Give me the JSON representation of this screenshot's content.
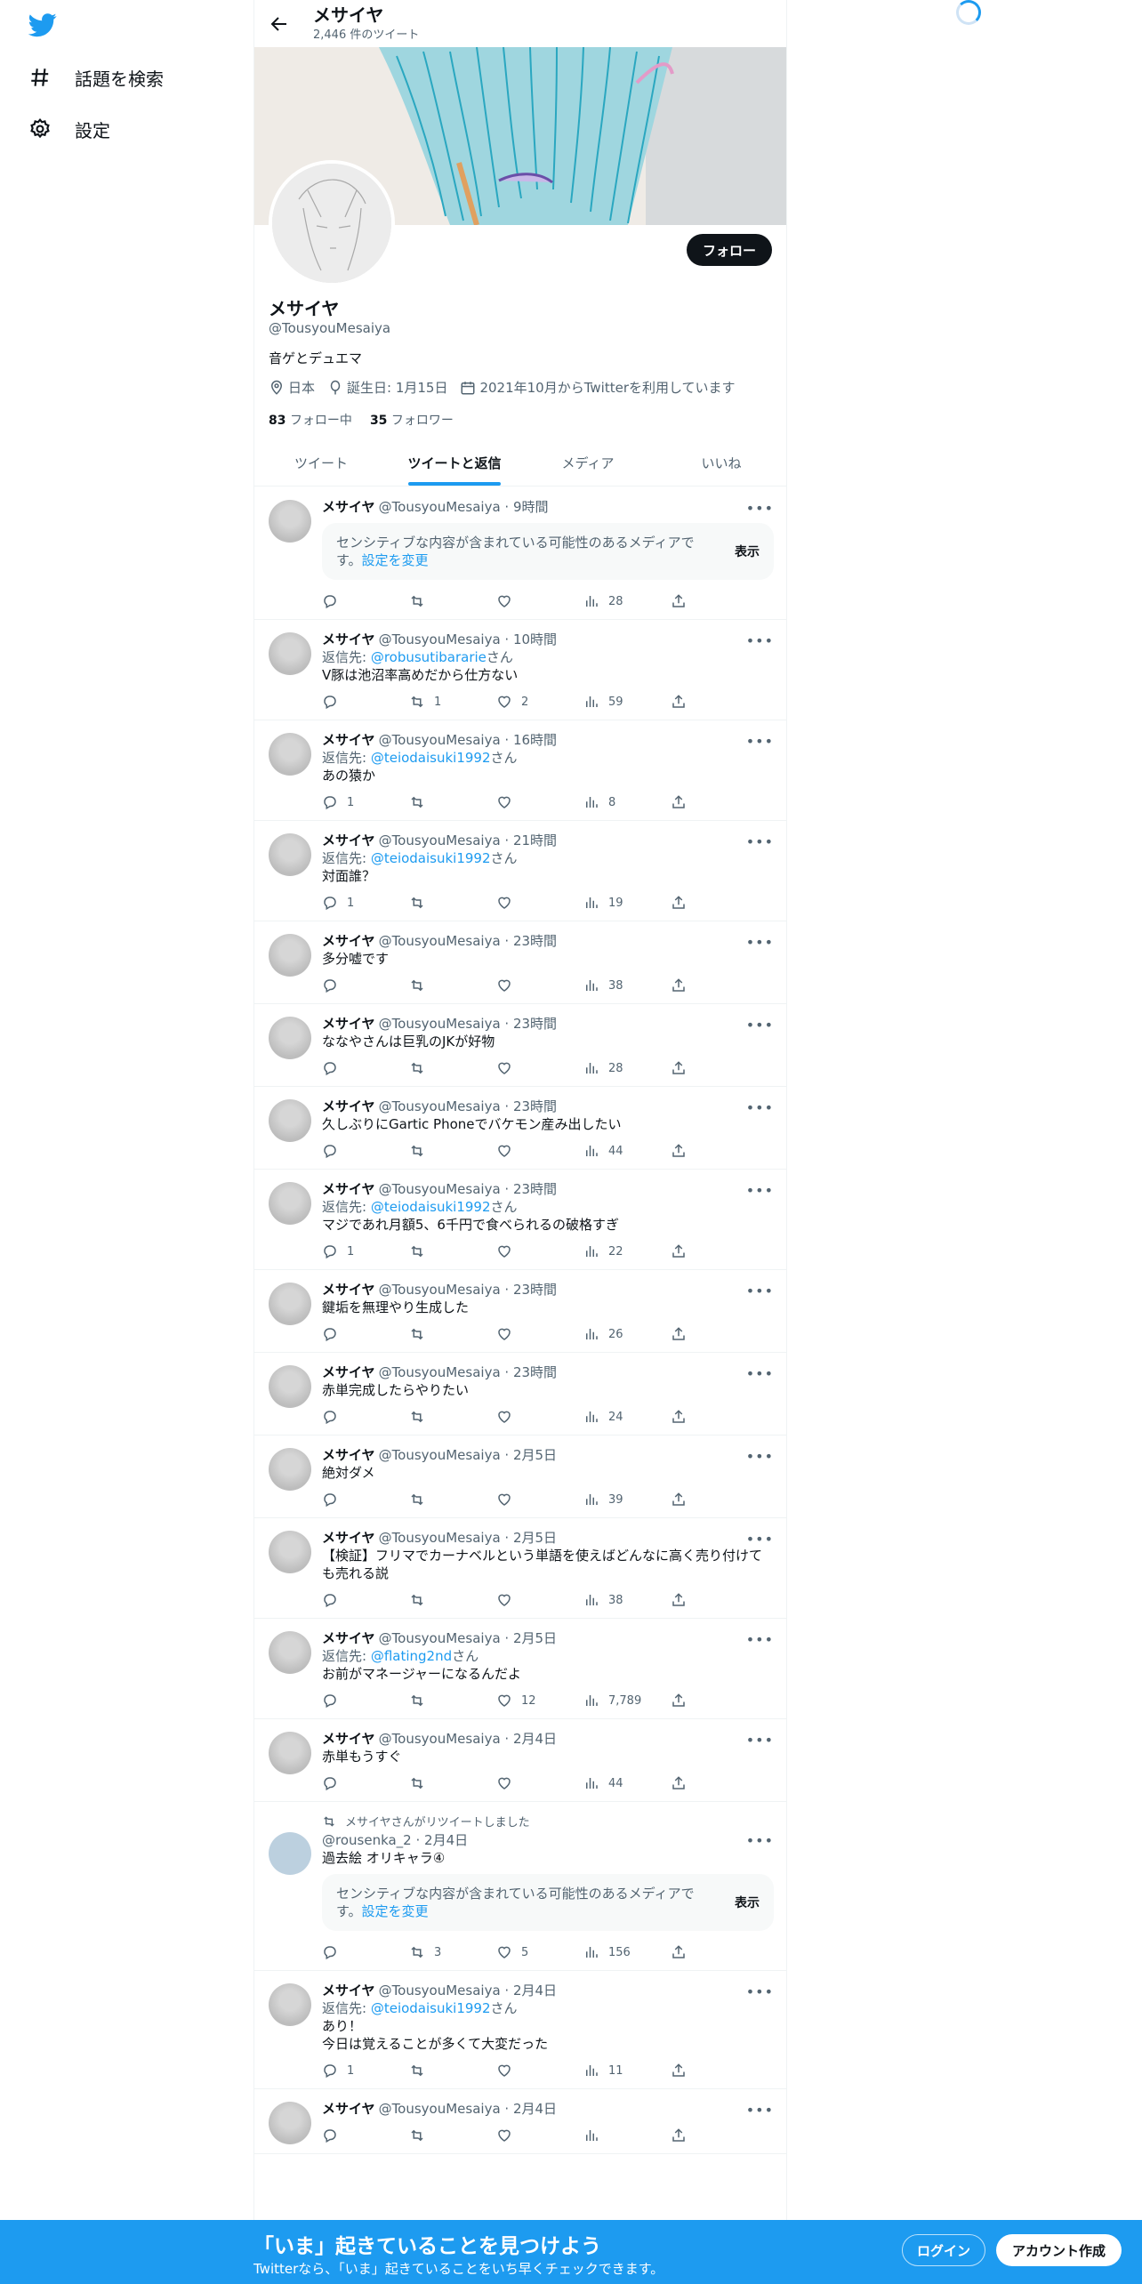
{
  "sidebar": {
    "items": [
      {
        "icon": "hashtag-icon",
        "label": "話題を検索"
      },
      {
        "icon": "gear-icon",
        "label": "設定"
      }
    ]
  },
  "header": {
    "name": "メサイヤ",
    "tweet_count": "2,446 件のツイート"
  },
  "profile": {
    "name": "メサイヤ",
    "handle": "@TousyouMesaiya",
    "bio": "音ゲとデュエマ",
    "location": "日本",
    "birthday": "誕生日: 1月15日",
    "joined": "2021年10月からTwitterを利用しています",
    "following_count": "83",
    "following_label": "フォロー中",
    "followers_count": "35",
    "followers_label": "フォロワー",
    "follow_button": "フォロー"
  },
  "tabs": [
    {
      "label": "ツイート"
    },
    {
      "label": "ツイートと返信"
    },
    {
      "label": "メディア"
    },
    {
      "label": "いいね"
    }
  ],
  "tweets": [
    {
      "name": "メサイヤ",
      "handle": "@TousyouMesaiya",
      "time": "9時間",
      "reply_to": "",
      "text": "",
      "sensitive": true,
      "replies": "",
      "retweets": "",
      "likes": "",
      "views": "28"
    },
    {
      "name": "メサイヤ",
      "handle": "@TousyouMesaiya",
      "time": "10時間",
      "reply_to": "@robusutibararie",
      "text": "V豚は池沼率高めだから仕方ない",
      "sensitive": false,
      "replies": "",
      "retweets": "1",
      "likes": "2",
      "views": "59"
    },
    {
      "name": "メサイヤ",
      "handle": "@TousyouMesaiya",
      "time": "16時間",
      "reply_to": "@teiodaisuki1992",
      "text": "あの猿か",
      "sensitive": false,
      "replies": "1",
      "retweets": "",
      "likes": "",
      "views": "8"
    },
    {
      "name": "メサイヤ",
      "handle": "@TousyouMesaiya",
      "time": "21時間",
      "reply_to": "@teiodaisuki1992",
      "text": "対面誰？",
      "sensitive": false,
      "replies": "1",
      "retweets": "",
      "likes": "",
      "views": "19"
    },
    {
      "name": "メサイヤ",
      "handle": "@TousyouMesaiya",
      "time": "23時間",
      "reply_to": "",
      "text": "多分嘘です",
      "sensitive": false,
      "replies": "",
      "retweets": "",
      "likes": "",
      "views": "38"
    },
    {
      "name": "メサイヤ",
      "handle": "@TousyouMesaiya",
      "time": "23時間",
      "reply_to": "",
      "text": "ななやさんは巨乳のJKが好物",
      "sensitive": false,
      "replies": "",
      "retweets": "",
      "likes": "",
      "views": "28"
    },
    {
      "name": "メサイヤ",
      "handle": "@TousyouMesaiya",
      "time": "23時間",
      "reply_to": "",
      "text": "久しぶりにGartic Phoneでバケモン産み出したい",
      "sensitive": false,
      "replies": "",
      "retweets": "",
      "likes": "",
      "views": "44"
    },
    {
      "name": "メサイヤ",
      "handle": "@TousyouMesaiya",
      "time": "23時間",
      "reply_to": "@teiodaisuki1992",
      "text": "マジであれ月額5、6千円で食べられるの破格すぎ",
      "sensitive": false,
      "replies": "1",
      "retweets": "",
      "likes": "",
      "views": "22"
    },
    {
      "name": "メサイヤ",
      "handle": "@TousyouMesaiya",
      "time": "23時間",
      "reply_to": "",
      "text": "鍵垢を無理やり生成した",
      "sensitive": false,
      "replies": "",
      "retweets": "",
      "likes": "",
      "views": "26"
    },
    {
      "name": "メサイヤ",
      "handle": "@TousyouMesaiya",
      "time": "23時間",
      "reply_to": "",
      "text": "赤単完成したらやりたい",
      "sensitive": false,
      "replies": "",
      "retweets": "",
      "likes": "",
      "views": "24"
    },
    {
      "name": "メサイヤ",
      "handle": "@TousyouMesaiya",
      "time": "2月5日",
      "reply_to": "",
      "text": "絶対ダメ",
      "sensitive": false,
      "replies": "",
      "retweets": "",
      "likes": "",
      "views": "39"
    },
    {
      "name": "メサイヤ",
      "handle": "@TousyouMesaiya",
      "time": "2月5日",
      "reply_to": "",
      "text": "【検証】フリマでカーナベルという単語を使えばどんなに高く売り付けても売れる説",
      "sensitive": false,
      "replies": "",
      "retweets": "",
      "likes": "",
      "views": "38"
    },
    {
      "name": "メサイヤ",
      "handle": "@TousyouMesaiya",
      "time": "2月5日",
      "reply_to": "@flating2nd",
      "text": "お前がマネージャーになるんだよ",
      "sensitive": false,
      "replies": "",
      "retweets": "",
      "likes": "12",
      "views": "7,789"
    },
    {
      "name": "メサイヤ",
      "handle": "@TousyouMesaiya",
      "time": "2月4日",
      "reply_to": "",
      "text": "赤単もうすぐ",
      "sensitive": false,
      "replies": "",
      "retweets": "",
      "likes": "",
      "views": "44"
    },
    {
      "retweeted_by": "メサイヤさんがリツイートしました",
      "name": "",
      "handle": "@rousenka_2",
      "time": "2月4日",
      "reply_to": "",
      "text": "過去絵 オリキャラ④",
      "sensitive": true,
      "replies": "",
      "retweets": "3",
      "likes": "5",
      "views": "156"
    },
    {
      "name": "メサイヤ",
      "handle": "@TousyouMesaiya",
      "time": "2月4日",
      "reply_to": "@teiodaisuki1992",
      "text": "あり！\n今日は覚えることが多くて大変だった",
      "sensitive": false,
      "replies": "1",
      "retweets": "",
      "likes": "",
      "views": "11"
    },
    {
      "name": "メサイヤ",
      "handle": "@TousyouMesaiya",
      "time": "2月4日",
      "reply_to": "",
      "text": "",
      "sensitive": false,
      "replies": "",
      "retweets": "",
      "likes": "",
      "views": ""
    }
  ],
  "strings": {
    "reply_prefix": "返信先: ",
    "reply_suffix": "さん",
    "sensitive_text": "センシティブな内容が含まれている可能性のあるメディアです。",
    "sensitive_link": "設定を変更",
    "sensitive_button": "表示"
  },
  "bottom_banner": {
    "title": "「いま」起きていることを見つけよう",
    "subtitle": "Twitterなら、「いま」起きていることをいち早くチェックできます。",
    "login": "ログイン",
    "signup": "アカウント作成"
  },
  "colors": {
    "accent": "#1d9bf0",
    "text": "#0f1419",
    "muted": "#536471"
  }
}
